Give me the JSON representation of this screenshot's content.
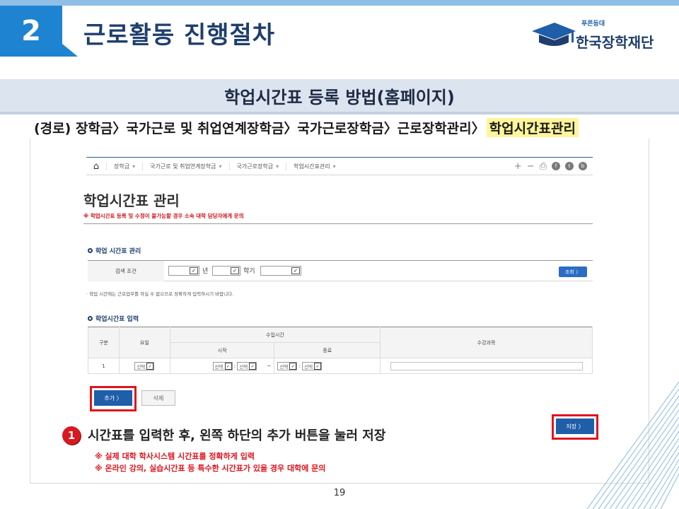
{
  "slide": {
    "number": "2",
    "title": "근로활동 진행절차",
    "logo_tagline": "푸른등대",
    "logo_name": "한국장학재단",
    "section_title": "학업시간표 등록 방법(홈페이지)",
    "path_prefix": "(경로) 장학금〉국가근로 및 취업연계장학금〉국가근로장학금〉근로장학관리〉",
    "path_highlight": "학업시간표관리",
    "page_number": "19"
  },
  "navbar": {
    "crumbs": [
      "장학금",
      "국가근로 및 취업연계장학금",
      "국가근로장학금",
      "학업시간표관리"
    ],
    "dropdown_glyph": "▾"
  },
  "page": {
    "heading": "학업시간표 관리",
    "warning": "※ 학업시간표 등록 및 수정이 불가능할 경우 소속 대학 담당자에게 문의"
  },
  "search_section": {
    "title": "학업 시간표 관리",
    "label": "검색 조건",
    "year_suffix": "년",
    "term_suffix": "학기",
    "lookup_button": "조회 〉",
    "note": "· 학업 시간에는 근로업무를 하실 수 없으므로 정확하게 입력하시기 바랍니다."
  },
  "entry_section": {
    "title": "학업시간표 입력",
    "headers": {
      "division": "구분",
      "day": "요일",
      "class_time": "수업시간",
      "start": "시작",
      "end": "종료",
      "course": "수강과목"
    },
    "row": {
      "index": "1",
      "select_label": "선택",
      "colon": ":",
      "tilde": "~"
    },
    "add_button": "추가 〉",
    "delete_button": "삭제",
    "save_button": "저장 〉"
  },
  "instructions": {
    "step_number": "1",
    "step_text": "시간표를 입력한 후, 왼쪽 하단의 추가 버튼을 눌러 저장",
    "warn1": "※ 실제 대학 학사시스템 시간표를 정확하게 입력",
    "warn2": "※ 온라인 강의, 실습시간표 등 특수한 시간표가 있을 경우 대학에 문의"
  },
  "colors": {
    "accent_blue": "#1e83d0",
    "navy": "#1f3e6e",
    "button_blue": "#1f5ea8",
    "highlight_red": "#e0141e",
    "path_highlight": "#fff59a"
  }
}
